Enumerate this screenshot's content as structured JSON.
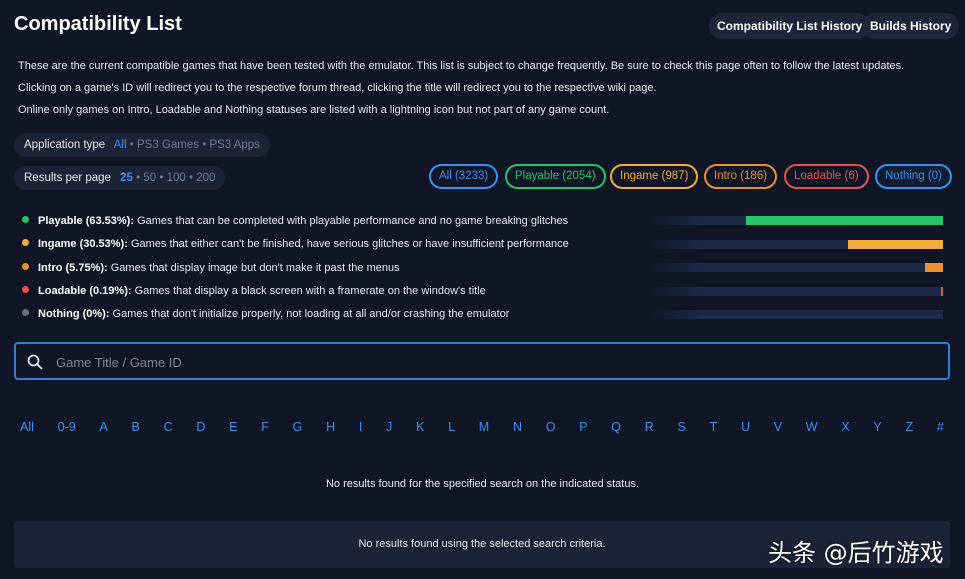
{
  "header": {
    "title": "Compatibility List",
    "history_button": "Compatibility List History",
    "builds_button": "Builds History"
  },
  "description": {
    "line1": "These are the current compatible games that have been tested with the emulator. This list is subject to change frequently. Be sure to check this page often to follow the latest updates.",
    "line2": "Clicking on a game's ID will redirect you to the respective forum thread, clicking the title will redirect you to the respective wiki page.",
    "line3": "Online only games on Intro, Loadable and Nothing statuses are listed with a lightning icon but not part of any game count."
  },
  "app_type": {
    "label": "Application type",
    "options": [
      "All",
      "PS3 Games",
      "PS3 Apps"
    ],
    "separator": "•"
  },
  "results_per_page": {
    "label": "Results per page",
    "options": [
      "25",
      "50",
      "100",
      "200"
    ],
    "separator": "•"
  },
  "status_filters": [
    {
      "label": "All (3233)",
      "color": "#3d8ff0"
    },
    {
      "label": "Playable (2054)",
      "color": "#27c46b"
    },
    {
      "label": "Ingame (987)",
      "color": "#f1ad39"
    },
    {
      "label": "Intro (186)",
      "color": "#e8912d"
    },
    {
      "label": "Loadable (6)",
      "color": "#e8504d"
    },
    {
      "label": "Nothing (0)",
      "color": "#3d8ff0"
    }
  ],
  "stats": [
    {
      "name": "Playable (63.53%):",
      "text": "Games that can be completed with playable performance and no game breaking glitches",
      "color": "#27c46b",
      "percent": 63.53
    },
    {
      "name": "Ingame (30.53%):",
      "text": "Games that either can't be finished, have serious glitches or have insufficient performance",
      "color": "#f1ad39",
      "percent": 30.53
    },
    {
      "name": "Intro (5.75%):",
      "text": "Games that display image but don't make it past the menus",
      "color": "#e8912d",
      "percent": 5.75
    },
    {
      "name": "Loadable (0.19%):",
      "text": "Games that display a black screen with a framerate on the window's title",
      "color": "#e8504d",
      "percent": 0.19
    },
    {
      "name": "Nothing (0%):",
      "text": "Games that don't initialize properly, not loading at all and/or crashing the emulator",
      "color": "#6c7280",
      "percent": 0
    }
  ],
  "search": {
    "placeholder": "Game Title / Game ID",
    "value": ""
  },
  "alphabet": [
    "All",
    "0-9",
    "A",
    "B",
    "C",
    "D",
    "E",
    "F",
    "G",
    "H",
    "I",
    "J",
    "K",
    "L",
    "M",
    "N",
    "O",
    "P",
    "Q",
    "R",
    "S",
    "T",
    "U",
    "V",
    "W",
    "X",
    "Y",
    "Z",
    "#"
  ],
  "messages": {
    "no_results_status": "No results found for the specified search on the indicated status.",
    "no_results_criteria": "No results found using the selected search criteria."
  },
  "watermark": "头条 @后竹游戏"
}
